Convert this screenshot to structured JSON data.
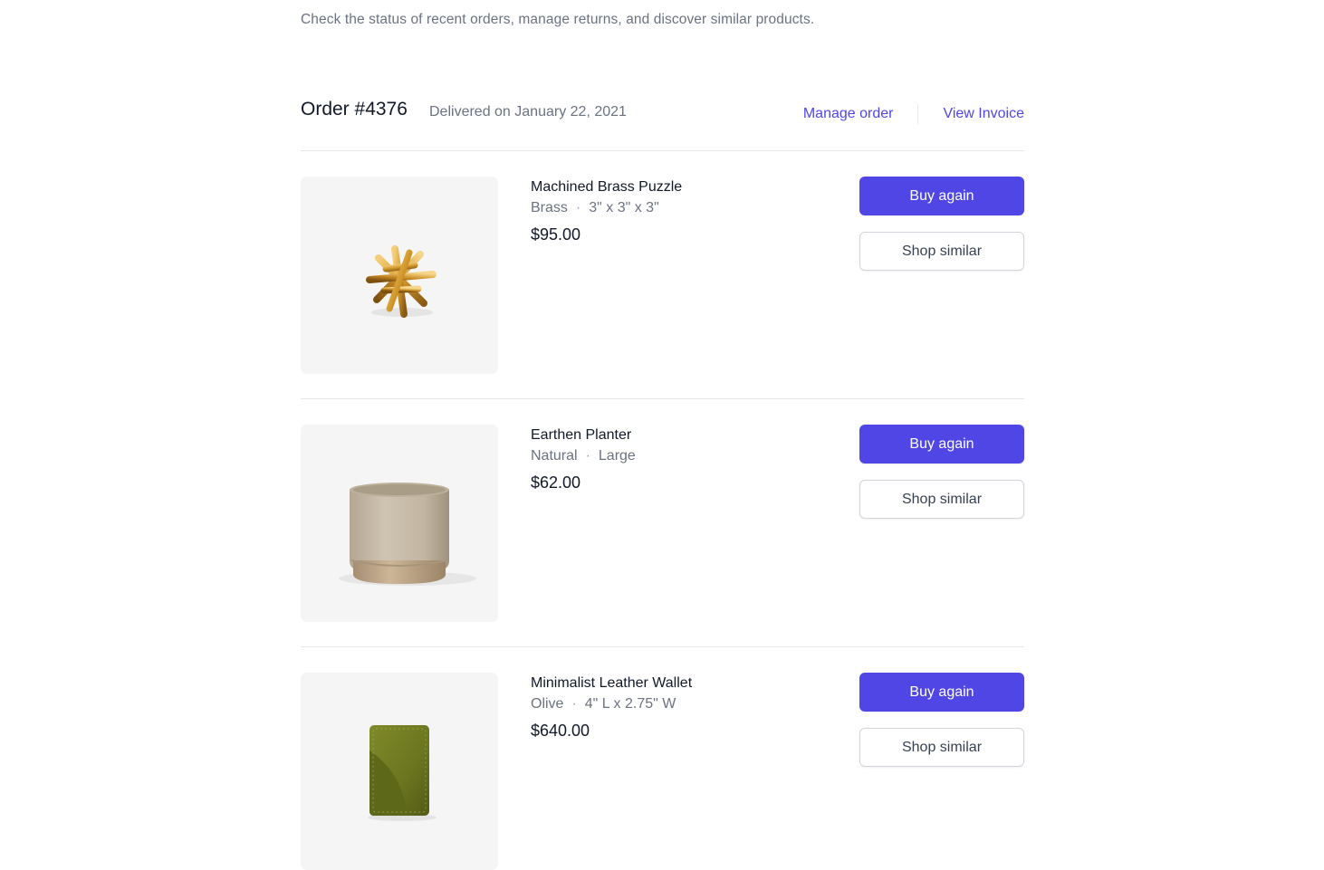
{
  "intro": {
    "text": "Check the status of recent orders, manage returns, and discover similar products."
  },
  "order": {
    "number": "Order #4376",
    "delivered": "Delivered on January 22, 2021",
    "manage_label": "Manage order",
    "invoice_label": "View Invoice"
  },
  "items": [
    {
      "name": "Machined Brass Puzzle",
      "variant": "Brass",
      "size": "3\" x 3\" x 3\"",
      "price": "$95.00",
      "buy_again_label": "Buy again",
      "shop_similar_label": "Shop similar",
      "image": "brass-puzzle-image"
    },
    {
      "name": "Earthen Planter",
      "variant": "Natural",
      "size": "Large",
      "price": "$62.00",
      "buy_again_label": "Buy again",
      "shop_similar_label": "Shop similar",
      "image": "planter-image"
    },
    {
      "name": "Minimalist Leather Wallet",
      "variant": "Olive",
      "size": "4\" L x 2.75\" W",
      "price": "$640.00",
      "buy_again_label": "Buy again",
      "shop_similar_label": "Shop similar",
      "image": "wallet-image"
    }
  ],
  "colors": {
    "accent": "#4f46e5",
    "text_primary": "#111827",
    "text_secondary": "#6b7280",
    "divider": "#e5e7eb",
    "thumbnail_bg": "#f5f5f5"
  }
}
